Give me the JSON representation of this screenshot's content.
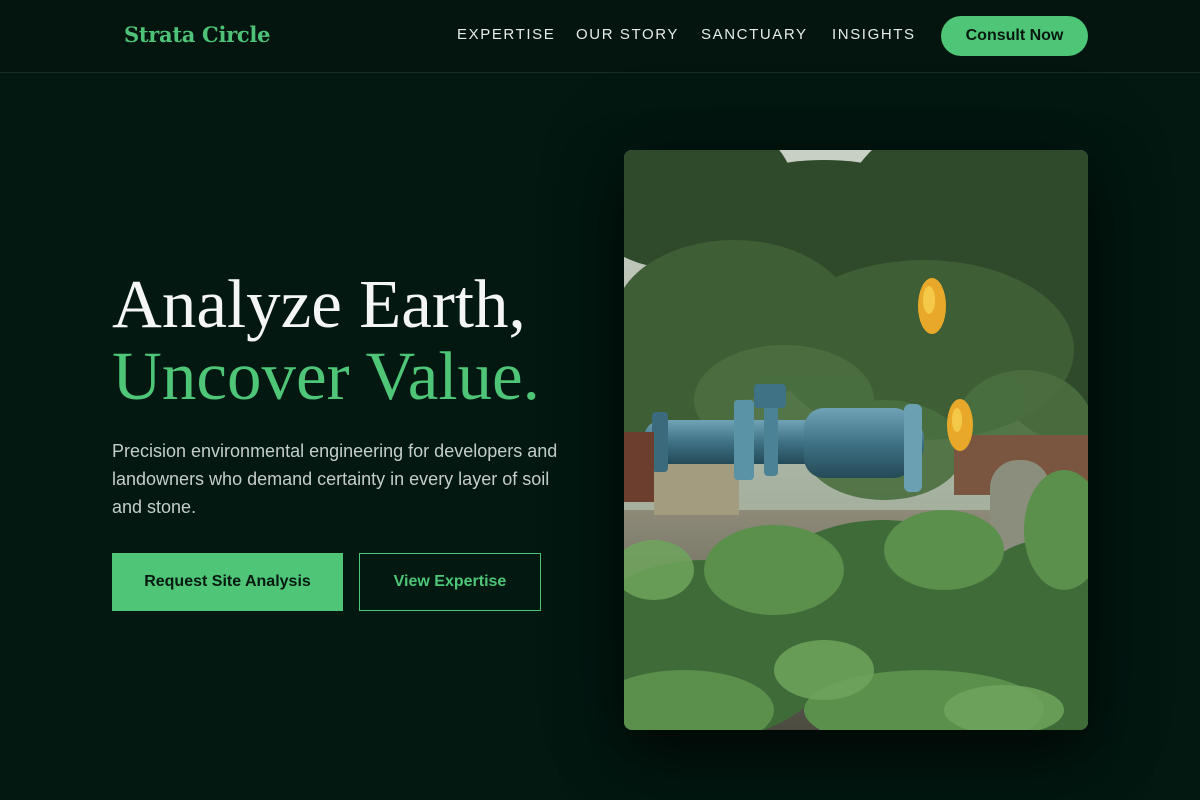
{
  "brand": {
    "logo_text": "Strata Circle"
  },
  "nav": {
    "items": [
      {
        "label": "EXPERTISE"
      },
      {
        "label": "OUR STORY"
      },
      {
        "label": "SANCTUARY"
      },
      {
        "label": "INSIGHTS"
      }
    ],
    "cta_label": "Consult Now"
  },
  "hero": {
    "headline_line1": "Analyze Earth,",
    "headline_line2": "Uncover Value.",
    "description": "Precision environmental engineering for developers and landowners who demand certainty in every layer of soil and stone.",
    "primary_button": "Request Site Analysis",
    "secondary_button": "View Expertise"
  },
  "colors": {
    "background": "#031811",
    "accent": "#4ec577",
    "text": "#f3f6f4"
  }
}
